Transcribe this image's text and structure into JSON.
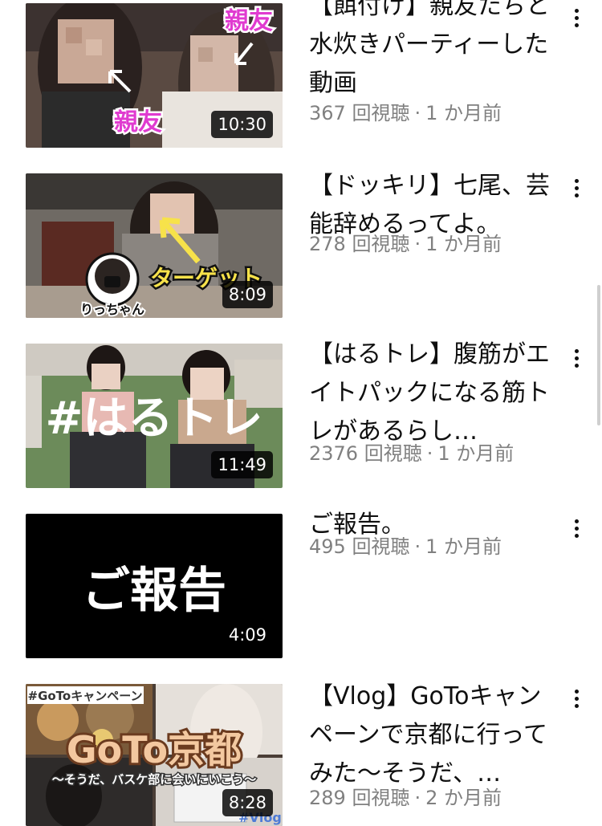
{
  "videos": [
    {
      "title": "【餌付け】親友たちと水炊きパーティーした動画",
      "views": "367 回視聴",
      "age": "1 か月前",
      "duration": "10:30",
      "overlay_top": "親友",
      "overlay_bottom": "親友"
    },
    {
      "title": "【ドッキリ】七尾、芸能辞めるってよ。",
      "views": "278 回視聴",
      "age": "1 か月前",
      "duration": "8:09",
      "overlay_target": "ターゲット",
      "overlay_name": "りっちゃん"
    },
    {
      "title": "【はるトレ】腹筋がエイトパックになる筋トレがあるらし…",
      "views": "2376 回視聴",
      "age": "1 か月前",
      "duration": "11:49",
      "overlay_main": "#はるトレ"
    },
    {
      "title": "ご報告。",
      "views": "495 回視聴",
      "age": "1 か月前",
      "duration": "4:09",
      "overlay_main": "ご報告"
    },
    {
      "title": "【Vlog】GoToキャンペーンで京都に行ってみた〜そうだ、…",
      "views": "289 回視聴",
      "age": "2 か月前",
      "duration": "8:28",
      "overlay_tag": "#GoToキャンペーン",
      "overlay_main": "GoTo京都",
      "overlay_sub": "〜そうだ、バスケ部に会いにいこう〜",
      "overlay_corner": "#Vlog"
    }
  ],
  "separator": "·",
  "colors": {
    "title_text": "#0f0f0f",
    "meta_text": "#808080",
    "duration_bg": "#000000",
    "overlay_pink": "#e03bd0",
    "overlay_yellow": "#f7e24a"
  }
}
